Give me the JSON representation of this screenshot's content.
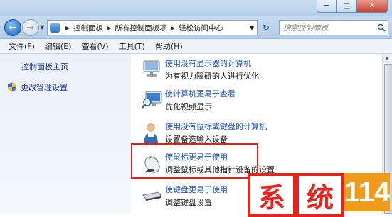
{
  "window": {
    "minimize_label": "─",
    "maximize_label": "□",
    "close_label": "✕"
  },
  "nav": {
    "back_icon": "back-arrow-icon",
    "forward_icon": "forward-arrow-icon",
    "breadcrumbs": [
      "控制面板",
      "所有控制面板项",
      "轻松访问中心"
    ],
    "search_placeholder": "搜索控制面板"
  },
  "menu": [
    "文件(F)",
    "编辑(E)",
    "查看(V)",
    "工具(T)",
    "帮助(H)"
  ],
  "sidebar": {
    "home_label": "控制面板主页",
    "admin_label": "更改管理设置"
  },
  "items": [
    {
      "icon": "display-monitor-icon",
      "link": "使用没有显示器的计算机",
      "desc": "为有视力障碍的人进行优化"
    },
    {
      "icon": "magnifier-monitor-icon",
      "link": "使计算机更易于查看",
      "desc": "优化视频显示"
    },
    {
      "icon": "user-keyboard-icon",
      "link": "使用没有鼠标或键盘的计算机",
      "desc": "设置备选输入设备"
    },
    {
      "icon": "mouse-icon",
      "link": "使鼠标更易于使用",
      "desc": "调整鼠标或其他指针设备的设置"
    },
    {
      "icon": "keyboard-icon",
      "link": "使键盘更易于使用",
      "desc": "调整键盘设置"
    }
  ],
  "watermark": {
    "chars": [
      "系",
      "统",
      "114"
    ]
  },
  "colors": {
    "highlight": "#e02020",
    "link": "#1e54b4",
    "logo_red": "#e7231b",
    "logo_orange": "#f19b1b"
  }
}
